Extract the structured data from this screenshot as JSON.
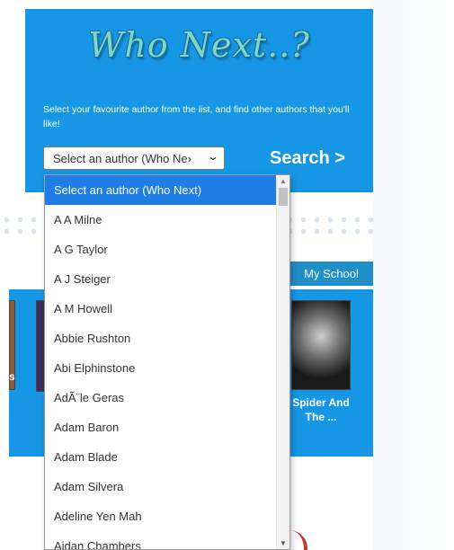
{
  "logo": {
    "text": "Who Next..?"
  },
  "intro": {
    "text": "Select your favourite author from the list, and find other authors that you'll like!"
  },
  "author_select": {
    "value": "Select an author (Who Ne›"
  },
  "search": {
    "label": "Search >"
  },
  "nav": {
    "my_school": "My School"
  },
  "books": {
    "right_caption_line1": "Spider And",
    "right_caption_line2": "The ...",
    "left_caption": "s"
  },
  "dropdown": {
    "options": [
      "Select an author (Who Next)",
      "A A Milne",
      "A G Taylor",
      "A J Steiger",
      "A M Howell",
      "Abbie Rushton",
      "Abi Elphinstone",
      "AdÃ¨le Geras",
      "Adam Baron",
      "Adam Blade",
      "Adam Silvera",
      "Adeline Yen Mah",
      "Aidan Chambers"
    ],
    "selected_index": 0
  },
  "colors": {
    "panel": "#1597e5",
    "selected": "#1e7ee6",
    "tab": "#1f8fc9"
  },
  "icons": {
    "chevron": "chevron-down-icon",
    "scroll_up": "arrow-up-icon",
    "scroll_down": "arrow-down-icon"
  }
}
